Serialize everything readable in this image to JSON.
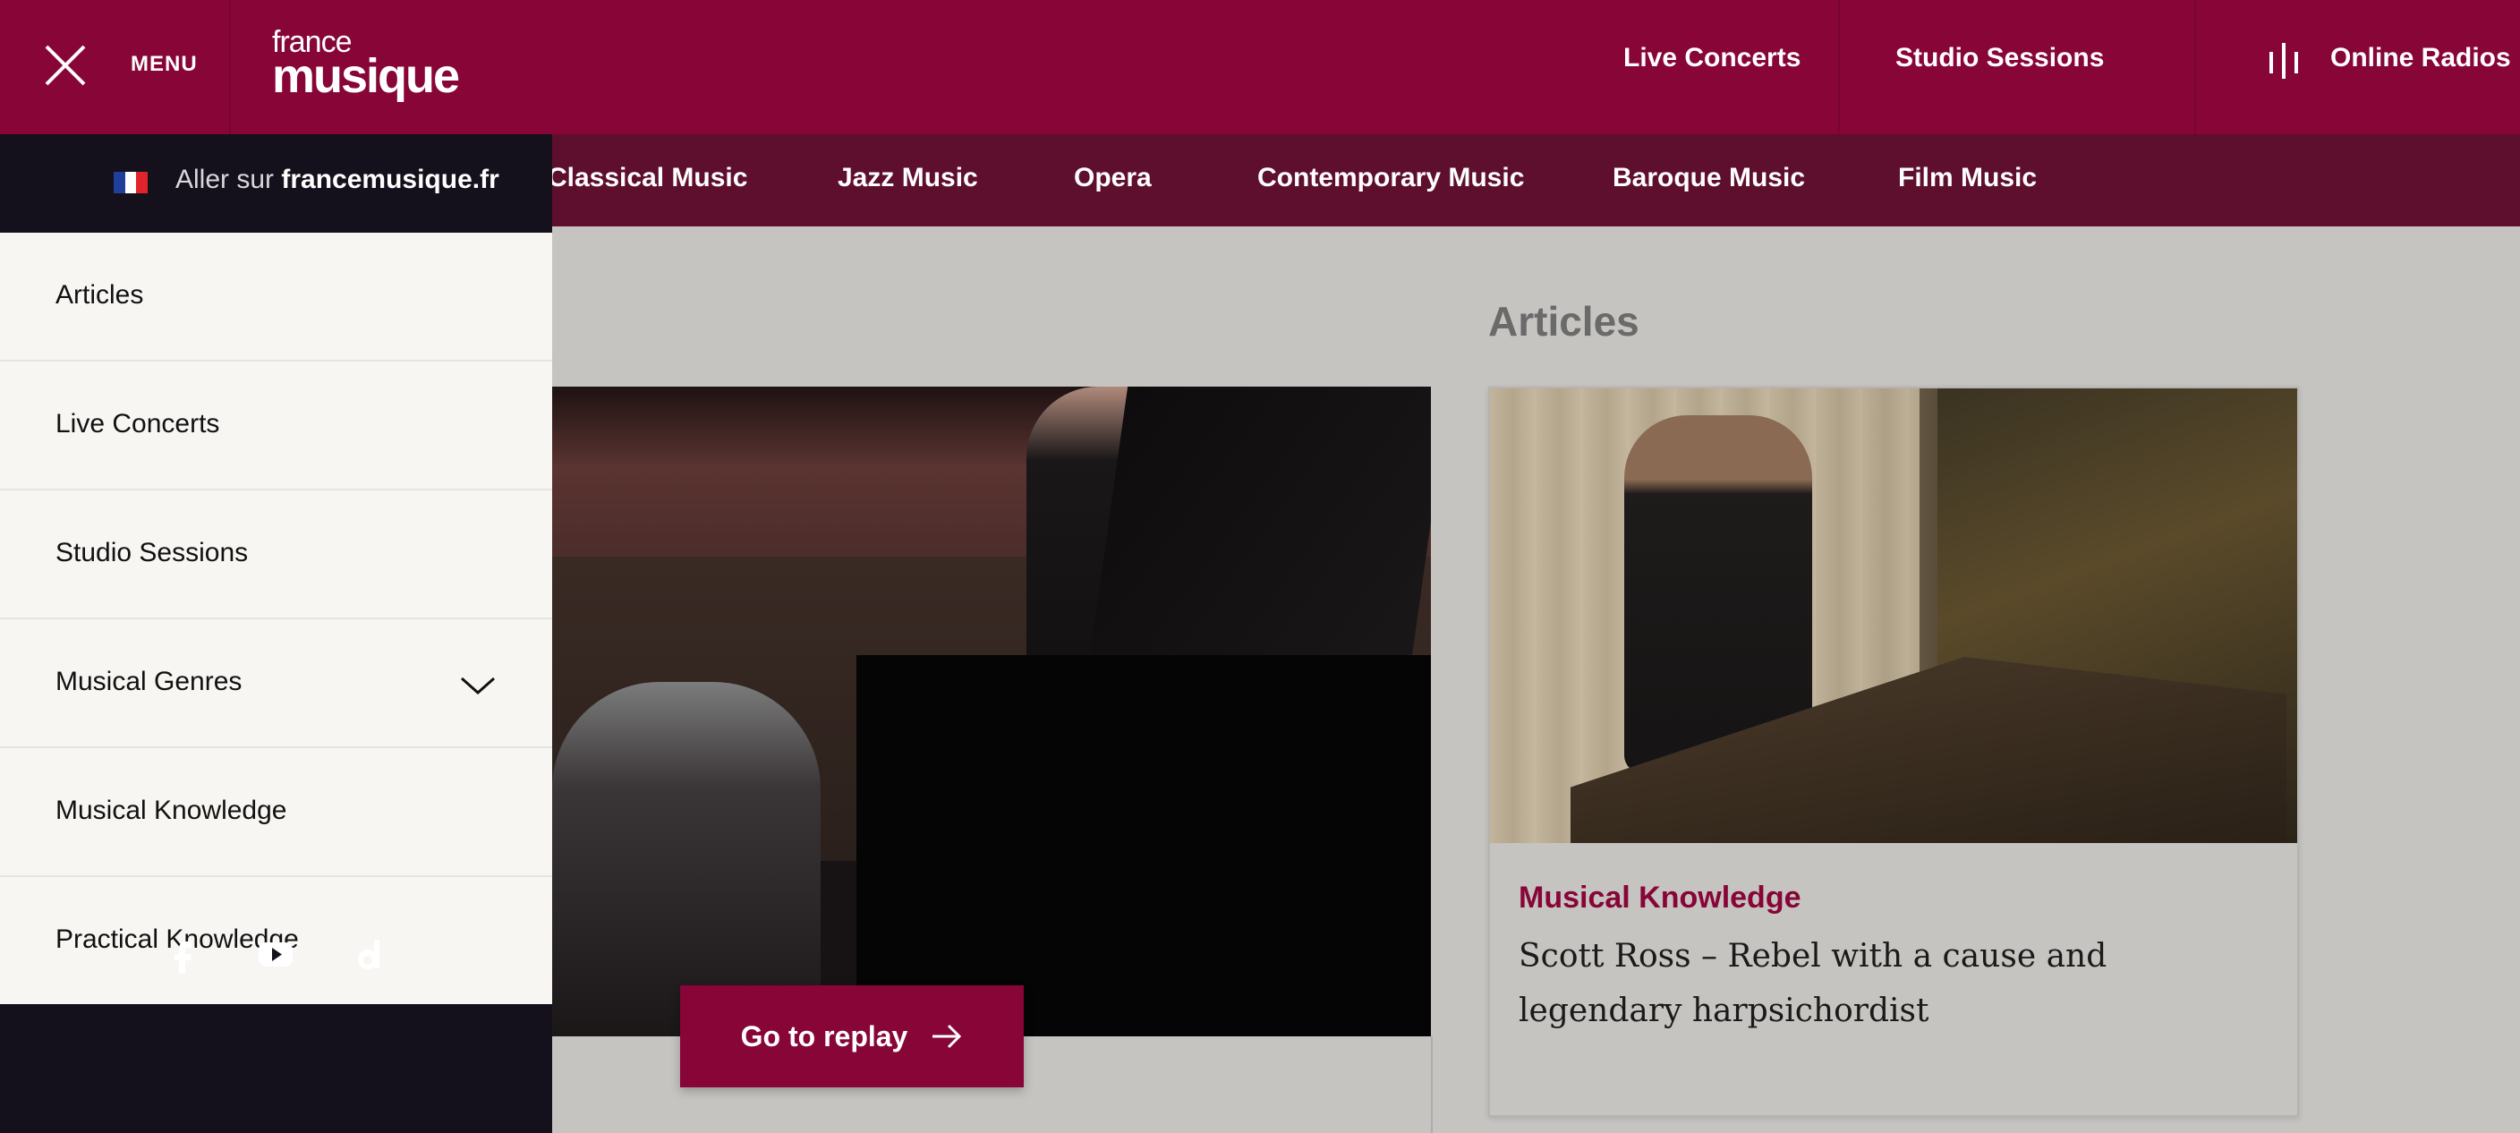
{
  "header": {
    "menu_label": "MENU",
    "logo_line1": "france",
    "logo_line2": "musique",
    "links": [
      "Live Concerts",
      "Studio Sessions",
      "Online Radios"
    ]
  },
  "genres": [
    "Classical Music",
    "Jazz Music",
    "Opera",
    "Contemporary Music",
    "Baroque Music",
    "Film Music"
  ],
  "menu": {
    "lang_prefix": "Aller sur ",
    "lang_site": "francemusique.fr",
    "items": [
      "Articles",
      "Live Concerts",
      "Studio Sessions",
      "Musical Genres",
      "Musical Knowledge",
      "Practical Knowledge"
    ],
    "social": [
      "facebook-icon",
      "youtube-icon",
      "dailymotion-icon"
    ]
  },
  "content": {
    "section_title": "Articles",
    "replay_label": "Go to replay",
    "card": {
      "category": "Musical Knowledge",
      "title": "Scott Ross – Rebel with a cause and legendary harpsichordist"
    }
  },
  "colors": {
    "brand": "#870537",
    "genre_bar": "#5e0f2d",
    "menu_dark": "#15111c",
    "menu_bg": "#f7f6f3"
  }
}
